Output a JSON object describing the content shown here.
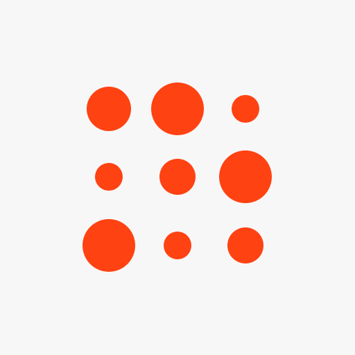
{
  "background_color": "#f8f7f7",
  "logo": {
    "name": "dot-grid-logo",
    "dot_color": "#ff4212",
    "rows": 3,
    "columns": 3
  }
}
